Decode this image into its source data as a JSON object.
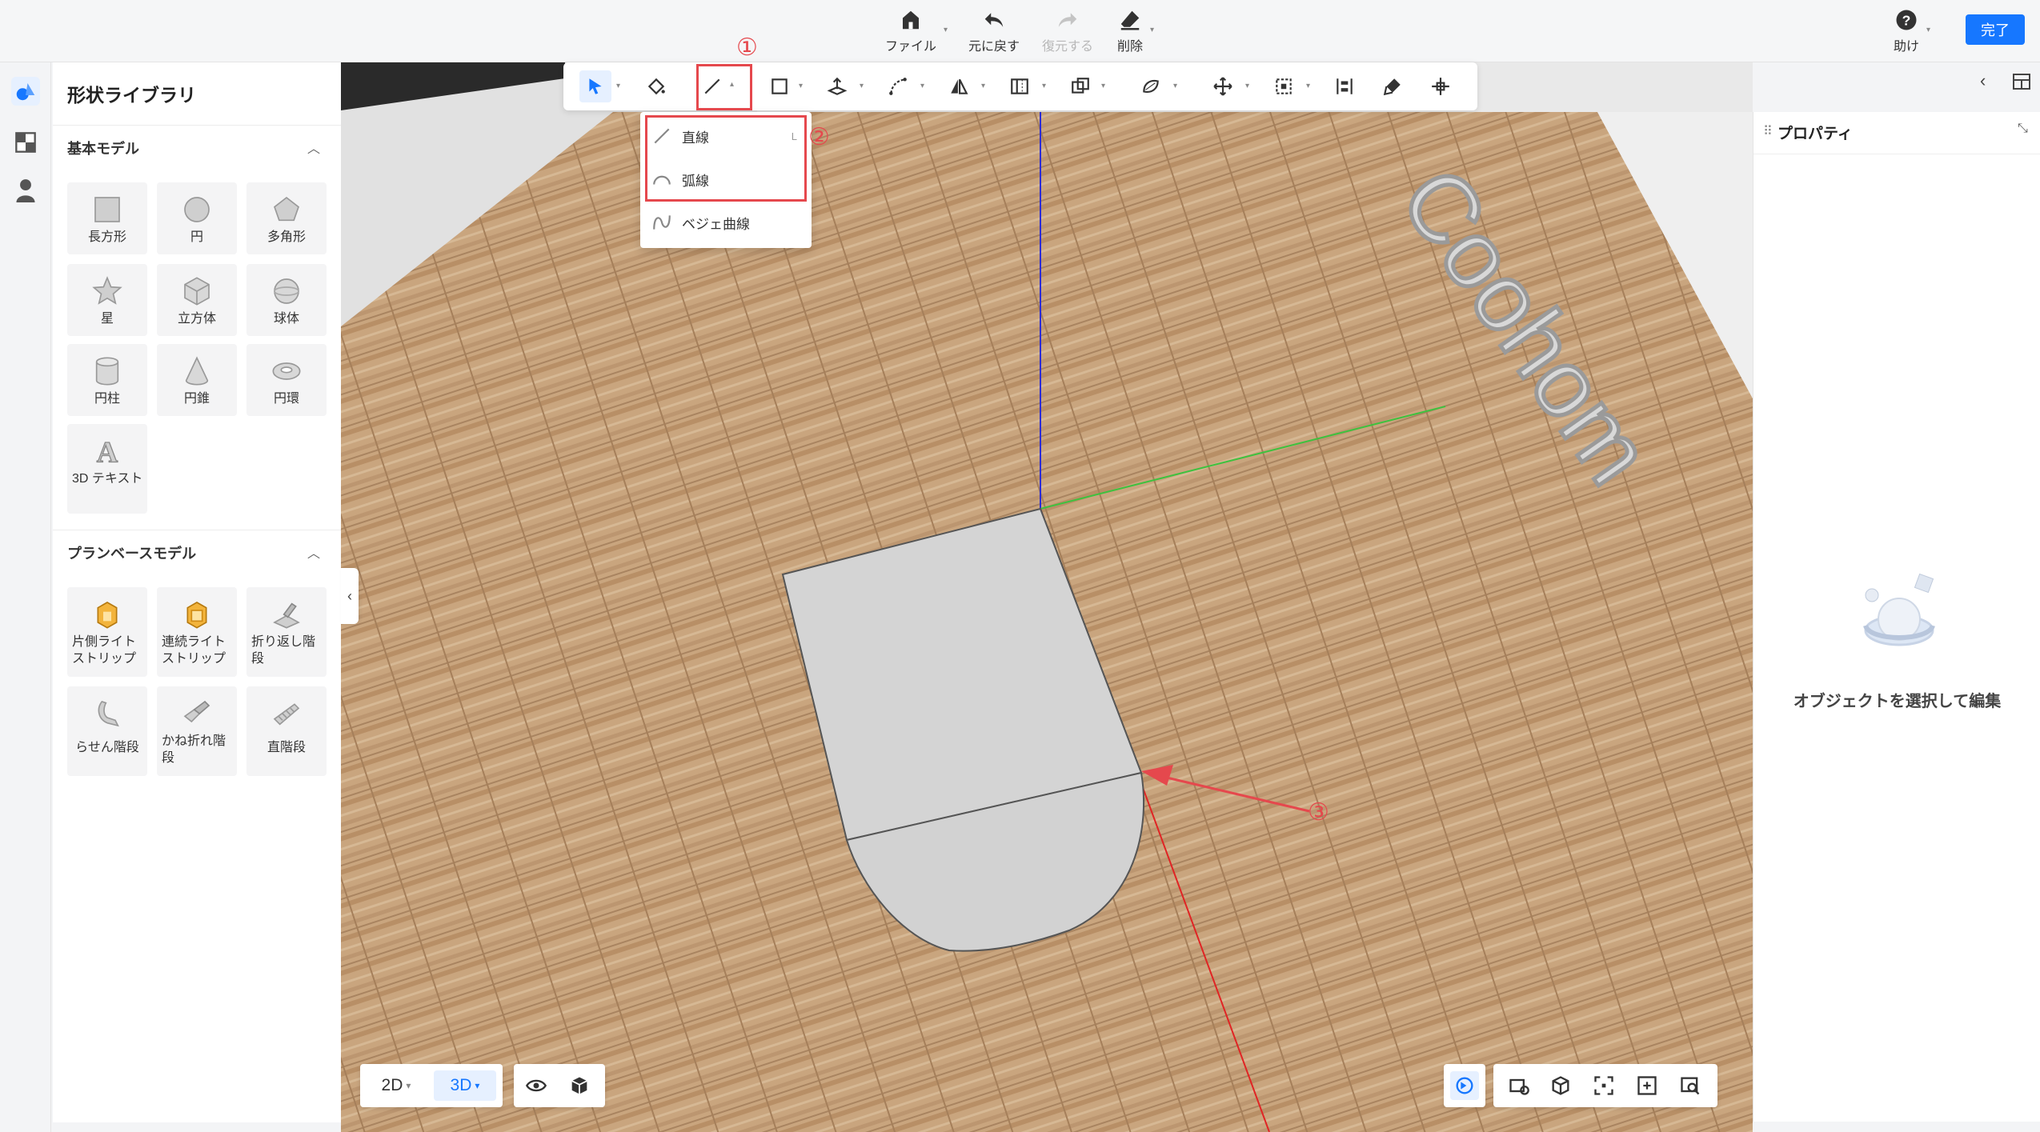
{
  "topbar": {
    "file": "ファイル",
    "undo": "元に戻す",
    "redo": "復元する",
    "delete": "削除",
    "help": "助け",
    "done": "完了"
  },
  "library": {
    "title": "形状ライブラリ",
    "basic_section": "基本モデル",
    "basic_items": [
      "長方形",
      "円",
      "多角形",
      "星",
      "立方体",
      "球体",
      "円柱",
      "円錐",
      "円環",
      "3D テキスト"
    ],
    "plan_section": "プランベースモデル",
    "plan_items": [
      "片側ライトストリップ",
      "連続ライトストリップ",
      "折り返し階段",
      "らせん階段",
      "かね折れ階段",
      "直階段"
    ]
  },
  "line_menu": {
    "items": [
      {
        "label": "直線",
        "shortcut": "L",
        "icon": "straight-line-icon"
      },
      {
        "label": "弧線",
        "shortcut": "",
        "icon": "arc-icon"
      },
      {
        "label": "ベジェ曲線",
        "shortcut": "",
        "icon": "bezier-icon"
      }
    ]
  },
  "annotations": {
    "n1": "①",
    "n2": "②",
    "n3": "③"
  },
  "scene": {
    "text3d": "Coohom"
  },
  "props": {
    "title": "プロパティ",
    "empty": "オブジェクトを選択して編集"
  },
  "view": {
    "mode_2d": "2D",
    "mode_3d": "3D",
    "active": "3D"
  },
  "colors": {
    "accent": "#1677ff",
    "annotation": "#e5484d",
    "floor": "#c9a57e"
  }
}
